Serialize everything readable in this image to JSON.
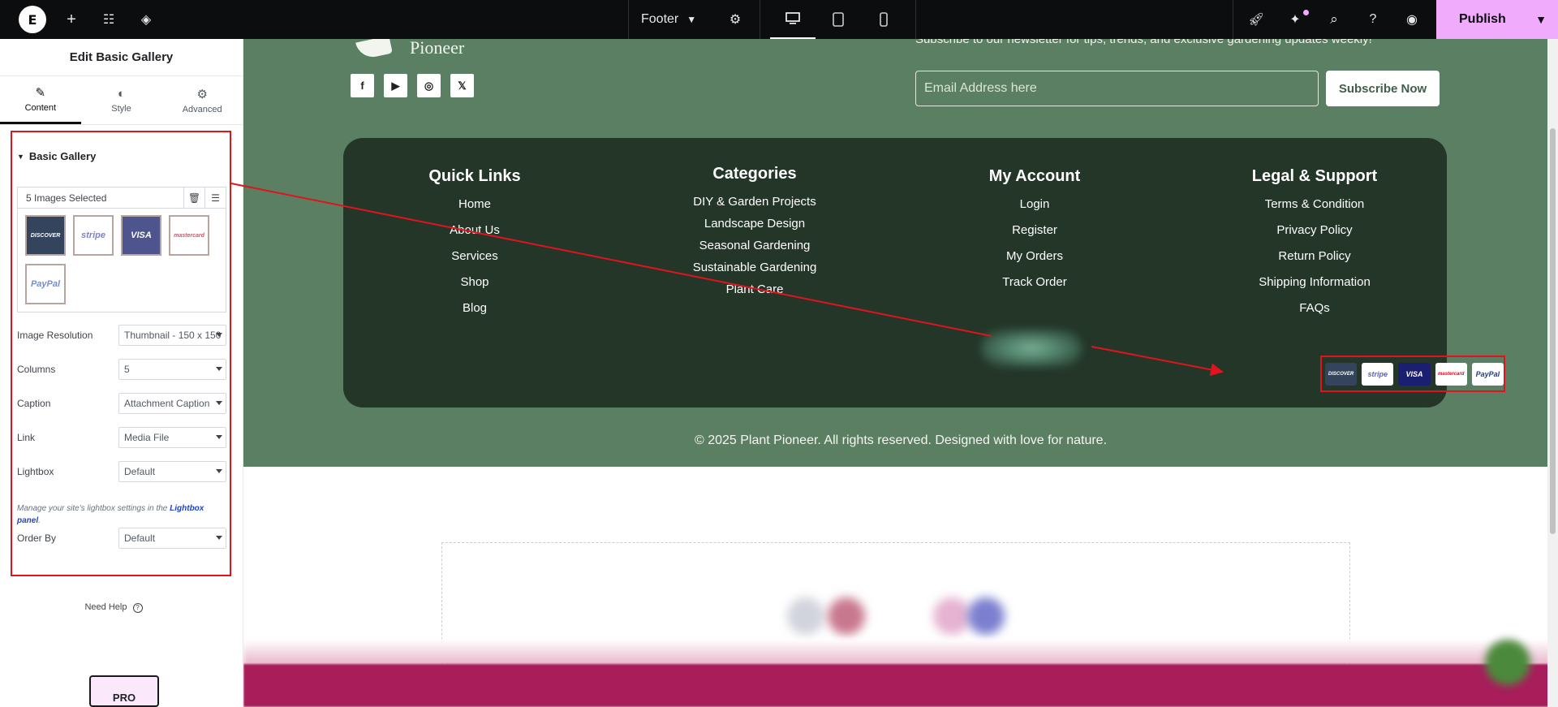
{
  "topbar": {
    "document_name": "Footer",
    "publish_label": "Publish"
  },
  "panel": {
    "title": "Edit Basic Gallery",
    "tabs": [
      {
        "label": "Content",
        "icon": "pencil-icon"
      },
      {
        "label": "Style",
        "icon": "half-circle-icon"
      },
      {
        "label": "Advanced",
        "icon": "gear-icon"
      }
    ],
    "section_title": "Basic Gallery",
    "images_selected": "5 Images Selected",
    "gallery_images": [
      {
        "label": "DISCOVER",
        "bg": "#33445c",
        "color": "#ffffff"
      },
      {
        "label": "stripe",
        "bg": "#ffffff",
        "color": "#7d82c7"
      },
      {
        "label": "VISA",
        "bg": "#4e558e",
        "color": "#ffffff"
      },
      {
        "label": "mastercard",
        "bg": "#ffffff",
        "color": "#d0556a"
      },
      {
        "label": "PayPal",
        "bg": "#ffffff",
        "color": "#6f8fd6"
      }
    ],
    "controls": [
      {
        "label": "Image Resolution",
        "value": "Thumbnail - 150 x 150"
      },
      {
        "label": "Columns",
        "value": "5"
      },
      {
        "label": "Caption",
        "value": "Attachment Caption"
      },
      {
        "label": "Link",
        "value": "Media File"
      },
      {
        "label": "Lightbox",
        "value": "Default"
      }
    ],
    "lightbox_note": "Manage your site's lightbox settings in the",
    "lightbox_link": "Lightbox panel",
    "order_by": {
      "label": "Order By",
      "value": "Default"
    },
    "need_help": "Need Help",
    "pro_badge": "PRO"
  },
  "footer": {
    "brand": "Pioneer",
    "newsletter_text": "Subscribe to our newsletter for tips, trends, and exclusive gardening updates weekly!",
    "email_placeholder": "Email Address here",
    "subscribe_label": "Subscribe Now",
    "socials": [
      "facebook-icon",
      "youtube-icon",
      "instagram-icon",
      "x-icon"
    ],
    "columns": [
      {
        "title": "Quick Links",
        "links": [
          "Home",
          "About Us",
          "Services",
          "Shop",
          "Blog"
        ]
      },
      {
        "title": "Categories",
        "links": [
          "DIY & Garden Projects",
          "Landscape Design",
          "Seasonal Gardening",
          "Sustainable Gardening",
          "Plant Care"
        ]
      },
      {
        "title": "My Account",
        "links": [
          "Login",
          "Register",
          "My Orders",
          "Track Order"
        ]
      },
      {
        "title": "Legal & Support",
        "links": [
          "Terms & Condition",
          "Privacy Policy",
          "Return Policy",
          "Shipping Information",
          "FAQs"
        ]
      }
    ],
    "payments": [
      {
        "label": "DISCOVER",
        "bg": "#33445c",
        "color": "#ffffff"
      },
      {
        "label": "stripe",
        "bg": "#ffffff",
        "color": "#5a63c8"
      },
      {
        "label": "VISA",
        "bg": "#1a1f71",
        "color": "#ffffff"
      },
      {
        "label": "mastercard",
        "bg": "#ffffff",
        "color": "#eb001b"
      },
      {
        "label": "PayPal",
        "bg": "#ffffff",
        "color": "#1f3f8f"
      }
    ],
    "copyright": "© 2025 Plant Pioneer. All rights reserved. Designed with love for nature."
  },
  "colors": {
    "footer_green": "#5b7f62",
    "card_dark": "#233628",
    "highlight_red": "#e0141e",
    "publish_pink": "#f0abfc"
  }
}
